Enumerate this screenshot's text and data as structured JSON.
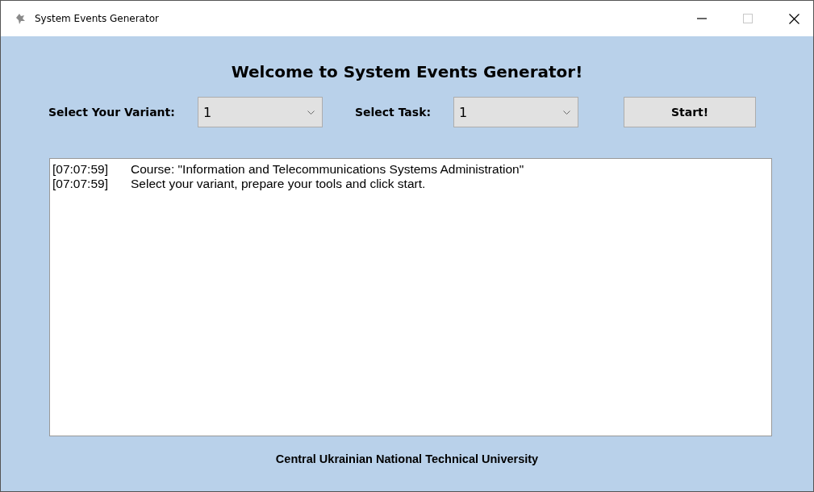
{
  "window": {
    "title": "System Events Generator",
    "maximize_disabled": true
  },
  "heading": "Welcome to System Events Generator!",
  "controls": {
    "variant_label": "Select Your Variant:",
    "variant_value": "1",
    "task_label": "Select Task:",
    "task_value": "1",
    "start_button": "Start!"
  },
  "log": [
    {
      "time": "[07:07:59]",
      "message": "Course: \"Information and Telecommunications Systems Administration\""
    },
    {
      "time": "[07:07:59]",
      "message": "Select your variant, prepare your tools and click start."
    }
  ],
  "footer": "Central Ukrainian National Technical University"
}
